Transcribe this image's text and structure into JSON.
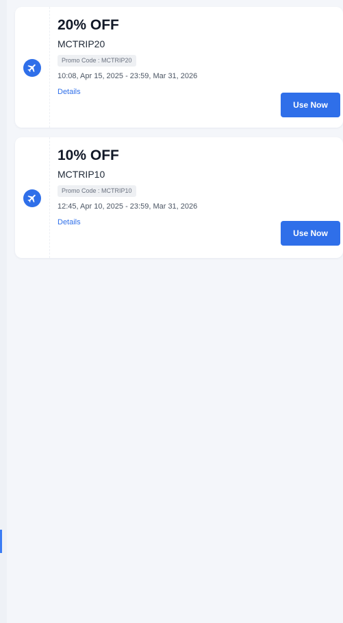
{
  "coupons": [
    {
      "title": "20% OFF",
      "code_name": "MCTRIP20",
      "promo_label": "Promo Code : MCTRIP20",
      "validity": "10:08, Apr 15, 2025 - 23:59, Mar 31, 2026",
      "details_label": "Details",
      "button_label": "Use Now",
      "icon": "airplane-icon"
    },
    {
      "title": "10% OFF",
      "code_name": "MCTRIP10",
      "promo_label": "Promo Code : MCTRIP10",
      "validity": "12:45, Apr 10, 2025 - 23:59, Mar 31, 2026",
      "details_label": "Details",
      "button_label": "Use Now",
      "icon": "airplane-icon"
    }
  ],
  "colors": {
    "accent": "#2f6fe9",
    "title": "#111827",
    "background": "#f4f6fa"
  }
}
